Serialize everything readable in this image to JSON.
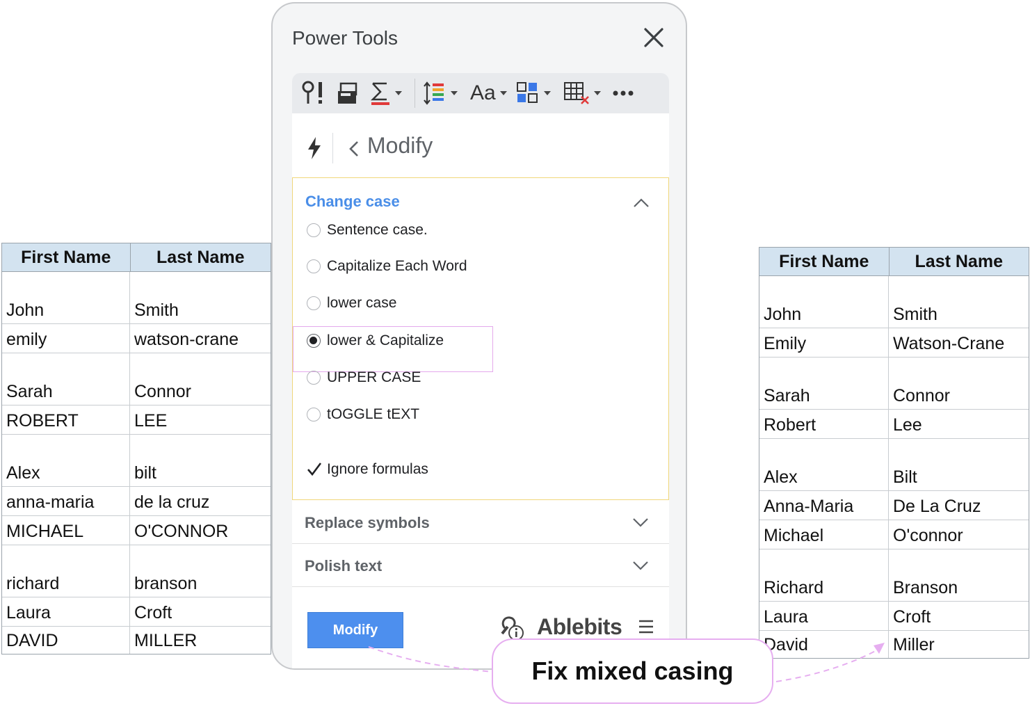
{
  "left_table": {
    "headers": [
      "First Name",
      "Last Name"
    ],
    "rows": [
      [
        "John",
        "Smith"
      ],
      [
        "emily",
        "watson-crane"
      ],
      [
        "Sarah",
        "Connor"
      ],
      [
        "ROBERT",
        "LEE"
      ],
      [
        "Alex",
        "bilt"
      ],
      [
        "anna-maria",
        "de la cruz"
      ],
      [
        "MICHAEL",
        "O'CONNOR"
      ],
      [
        "richard",
        "branson"
      ],
      [
        "Laura",
        "Croft"
      ],
      [
        "DAVID",
        "MILLER"
      ]
    ]
  },
  "right_table": {
    "headers": [
      "First Name",
      "Last Name"
    ],
    "rows": [
      [
        "John",
        "Smith"
      ],
      [
        "Emily",
        "Watson-Crane"
      ],
      [
        "Sarah",
        "Connor"
      ],
      [
        "Robert",
        "Lee"
      ],
      [
        "Alex",
        "Bilt"
      ],
      [
        "Anna-Maria",
        "De La Cruz"
      ],
      [
        "Michael",
        "O'connor"
      ],
      [
        "Richard",
        "Branson"
      ],
      [
        "Laura",
        "Croft"
      ],
      [
        "David",
        "Miller"
      ]
    ]
  },
  "sidebar": {
    "title": "Power Tools",
    "toolbar_icons": [
      "split-icon",
      "merge-icon",
      "sum-icon",
      "sort-icon",
      "text-case-icon",
      "group-icon",
      "clear-table-icon",
      "more-icon"
    ],
    "toolbar_text": "Aa",
    "breadcrumb": "Modify",
    "change_case": {
      "title": "Change case",
      "options": [
        "Sentence case.",
        "Capitalize Each Word",
        "lower case",
        "lower & Capitalize",
        "UPPER CASE",
        "tOGGLE tEXT"
      ],
      "selected": "lower & Capitalize",
      "ignore_formulas": "Ignore formulas",
      "ignore_checked": true
    },
    "replace_symbols": "Replace symbols",
    "polish_text": "Polish text",
    "modify_button": "Modify",
    "brand": "Ablebits"
  },
  "callout": "Fix mixed casing",
  "colors": {
    "accent": "#4a8ee8",
    "button": "#4d8fee",
    "header_bg": "#d3e3f0",
    "callout_border": "#e6aef0",
    "section_border": "#f0d77a"
  }
}
